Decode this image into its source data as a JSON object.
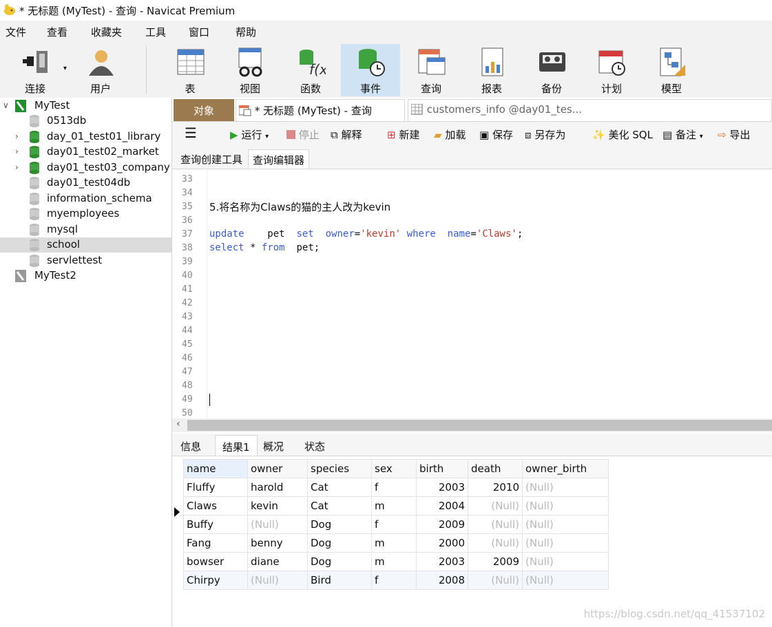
{
  "window": {
    "title": "* 无标题 (MyTest) - 查询 - Navicat Premium"
  },
  "menu": [
    "文件",
    "查看",
    "收藏夹",
    "工具",
    "窗口",
    "帮助"
  ],
  "toolbar": {
    "connect": "连接",
    "user": "用户",
    "table": "表",
    "view": "视图",
    "function": "函数",
    "event": "事件",
    "query": "查询",
    "report": "报表",
    "backup": "备份",
    "schedule": "计划",
    "model": "模型"
  },
  "sidebar": {
    "items": [
      {
        "label": "MyTest"
      },
      {
        "label": "0513db"
      },
      {
        "label": "day_01_test01_library"
      },
      {
        "label": "day01_test02_market"
      },
      {
        "label": "day01_test03_company"
      },
      {
        "label": "day01_test04db"
      },
      {
        "label": "information_schema"
      },
      {
        "label": "myemployees"
      },
      {
        "label": "mysql"
      },
      {
        "label": "school"
      },
      {
        "label": "servlettest"
      },
      {
        "label": "MyTest2"
      }
    ]
  },
  "tabs": {
    "objects": "对象",
    "query": "* 无标题 (MyTest) - 查询",
    "customers": "customers_info @day01_tes..."
  },
  "query_toolbar": {
    "run": "运行",
    "stop": "停止",
    "explain": "解释",
    "new": "新建",
    "load": "加载",
    "save": "保存",
    "save_as": "另存为",
    "beautify": "美化 SQL",
    "comment": "备注",
    "export": "导出"
  },
  "subtabs": {
    "builder": "查询创建工具",
    "editor": "查询编辑器"
  },
  "editor": {
    "line_numbers": [
      "33",
      "34",
      "35",
      "36",
      "37",
      "38",
      "39",
      "40",
      "41",
      "42",
      "43",
      "44",
      "45",
      "46",
      "47",
      "48",
      "49",
      "50"
    ],
    "comment_line": "5.将名称为Claws的猫的主人改为kevin",
    "update": {
      "kw_update": "update",
      "table": "pet",
      "kw_set": "set",
      "col_owner": "owner",
      "eq": "=",
      "val_owner": "'kevin'",
      "kw_where": "where",
      "col_name": "name",
      "val_name": "'Claws'",
      "semi": ";"
    },
    "select": {
      "kw_select": "select",
      "star": "*",
      "kw_from": "from",
      "table": "pet;"
    }
  },
  "result_tabs": {
    "info": "信息",
    "result1": "结果1",
    "profile": "概况",
    "status": "状态"
  },
  "result": {
    "columns": [
      "name",
      "owner",
      "species",
      "sex",
      "birth",
      "death",
      "owner_birth"
    ],
    "rows": [
      [
        "Fluffy",
        "harold",
        "Cat",
        "f",
        "2003",
        "2010",
        "(Null)"
      ],
      [
        "Claws",
        "kevin",
        "Cat",
        "m",
        "2004",
        "(Null)",
        "(Null)"
      ],
      [
        "Buffy",
        "(Null)",
        "Dog",
        "f",
        "2009",
        "(Null)",
        "(Null)"
      ],
      [
        "Fang",
        "benny",
        "Dog",
        "m",
        "2000",
        "(Null)",
        "(Null)"
      ],
      [
        "bowser",
        "diane",
        "Dog",
        "m",
        "2003",
        "2009",
        "(Null)"
      ],
      [
        "Chirpy",
        "(Null)",
        "Bird",
        "f",
        "2008",
        "(Null)",
        "(Null)"
      ]
    ]
  },
  "watermark": "https://blog.csdn.net/qq_41537102",
  "colors": {
    "accent": "#cfe3f5",
    "keyword": "#3b5bd9",
    "string": "#c0392b",
    "objects_tab": "#9b7a4f",
    "db_green": "#3fa33f"
  }
}
